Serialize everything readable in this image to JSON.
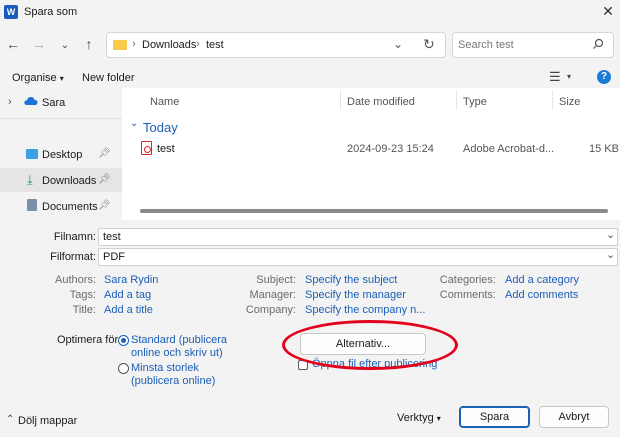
{
  "window": {
    "title": "Spara som",
    "app_icon": "W"
  },
  "nav": {
    "breadcrumb_root": "Downloads",
    "breadcrumb_leaf": "test",
    "search_placeholder": "Search test"
  },
  "toolbar": {
    "organise_label": "Organise",
    "new_folder_label": "New folder"
  },
  "sidebar": {
    "items": [
      {
        "label": "Sara",
        "icon": "cloud-icon"
      },
      {
        "label": "Desktop",
        "icon": "desktop-icon"
      },
      {
        "label": "Downloads",
        "icon": "download-icon"
      },
      {
        "label": "Documents",
        "icon": "documents-icon"
      }
    ]
  },
  "file_list": {
    "columns": [
      "Name",
      "Date modified",
      "Type",
      "Size"
    ],
    "group_label": "Today",
    "rows": [
      {
        "name": "test",
        "date": "2024-09-23 15:24",
        "type": "Adobe Acrobat-d...",
        "size": "15 KB"
      }
    ]
  },
  "form": {
    "filename_label": "Filnamn:",
    "filename_value": "test",
    "filetype_label": "Filformat:",
    "filetype_value": "PDF"
  },
  "metadata": {
    "authors_label": "Authors:",
    "authors_value": "Sara Rydin",
    "tags_label": "Tags:",
    "tags_value": "Add a tag",
    "title_label": "Title:",
    "title_value": "Add a title",
    "subject_label": "Subject:",
    "subject_value": "Specify the subject",
    "manager_label": "Manager:",
    "manager_value": "Specify the manager",
    "company_label": "Company:",
    "company_value": "Specify the company n...",
    "categories_label": "Categories:",
    "categories_value": "Add a category",
    "comments_label": "Comments:",
    "comments_value": "Add comments"
  },
  "optimize": {
    "label": "Optimera för:",
    "option1_line1": "Standard (publicera",
    "option1_line2": "online och skriv ut)",
    "option2_line1": "Minsta storlek",
    "option2_line2": "(publicera online)"
  },
  "options": {
    "alternativ_label": "Alternativ...",
    "open_after_label": "Öppna fil efter publicering"
  },
  "footer": {
    "hide_folders_label": "Dölj mappar",
    "tools_label": "Verktyg",
    "save_label": "Spara",
    "cancel_label": "Avbryt"
  },
  "colors": {
    "accent": "#1b5fb6",
    "annotation_red": "#e3001b"
  }
}
